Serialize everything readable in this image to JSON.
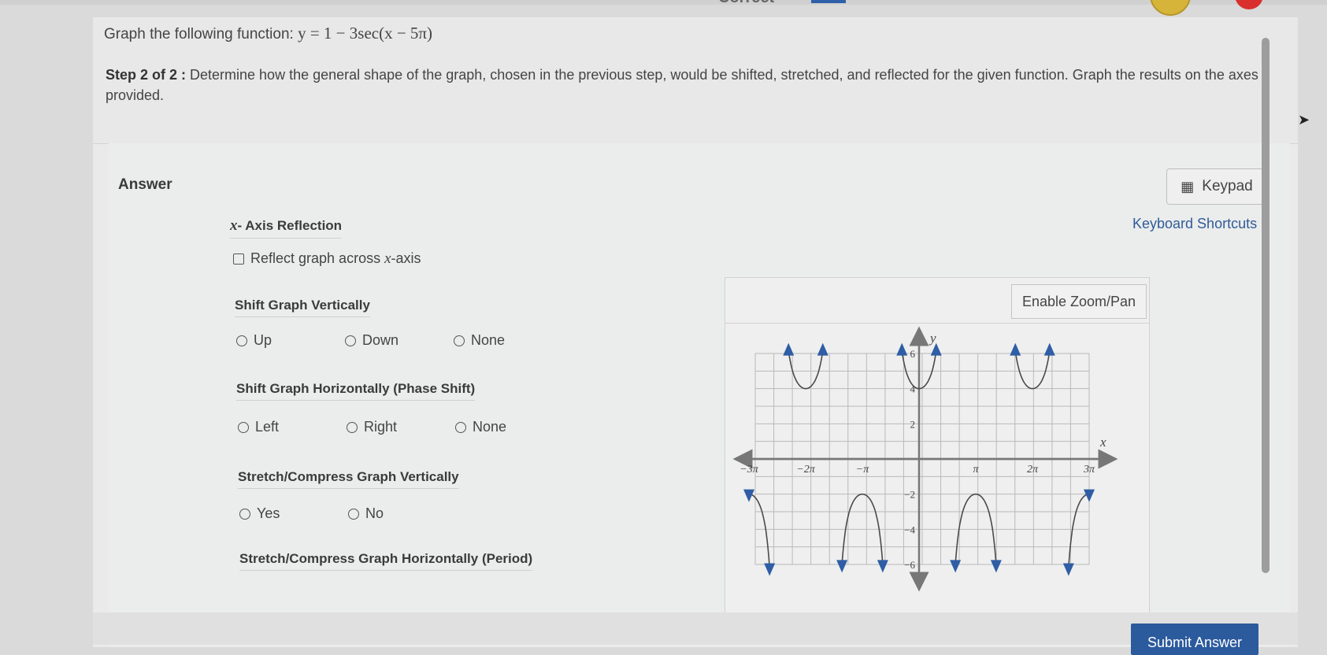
{
  "header": {
    "partial_text": "Correct"
  },
  "question": {
    "title_prefix": "Graph the following function: ",
    "title_math": "y = 1 − 3sec(x − 5π)",
    "step_label": "Step 2 of 2 :",
    "step_text": " Determine how the general shape of the graph, chosen in the previous step, would be shifted, stretched, and reflected for the given function. Graph the results on the axes provided."
  },
  "answer": {
    "label": "Answer",
    "keypad_label": "Keypad",
    "keypad_icon": "calculator-icon",
    "shortcuts_label": "Keyboard Shortcuts",
    "reflection": {
      "title_var": "x",
      "title_rest": "- Axis Reflection",
      "checkbox_label_prefix": "Reflect graph across ",
      "checkbox_label_var": "x",
      "checkbox_label_suffix": "-axis"
    },
    "shift_vertical": {
      "title": "Shift Graph Vertically",
      "options": [
        "Up",
        "Down",
        "None"
      ]
    },
    "shift_horizontal": {
      "title": "Shift Graph Horizontally (Phase Shift)",
      "options": [
        "Left",
        "Right",
        "None"
      ]
    },
    "stretch_vertical": {
      "title": "Stretch/Compress Graph Vertically",
      "options": [
        "Yes",
        "No"
      ]
    },
    "stretch_horizontal": {
      "title": "Stretch/Compress Graph Horizontally (Period)"
    }
  },
  "graph": {
    "zoom_label": "Enable Zoom/Pan",
    "x_axis_label": "x",
    "y_axis_label": "y",
    "x_ticks": [
      "−3π",
      "−2π",
      "−π",
      "π",
      "2π",
      "3π"
    ],
    "y_ticks": [
      "6",
      "4",
      "2",
      "−2",
      "−4",
      "−6"
    ],
    "curve_color": "#2f5da6"
  },
  "footer": {
    "submit_label": "Submit Answer"
  }
}
